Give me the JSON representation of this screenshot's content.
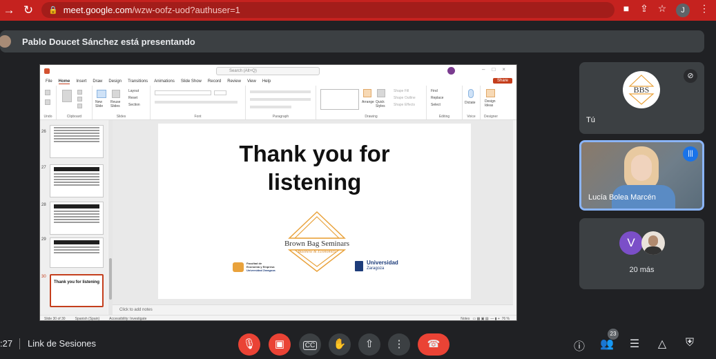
{
  "browser": {
    "url_domain": "meet.google.com",
    "url_path": "/wzw-oofz-uod?authuser=1",
    "profile_initial": "J",
    "accent": "#c5221f"
  },
  "presenter_bar": {
    "text": "Pablo Doucet Sánchez está presentando"
  },
  "ppt": {
    "menus": [
      "File",
      "Home",
      "Insert",
      "Draw",
      "Design",
      "Transitions",
      "Animations",
      "Slide Show",
      "Record",
      "Review",
      "View",
      "Help"
    ],
    "share_label": "Share",
    "search_placeholder": "Search (Alt+Q)",
    "ribbon": {
      "groups": [
        "Undo",
        "Clipboard",
        "Slides",
        "Font",
        "Paragraph",
        "Drawing",
        "Editing",
        "Voice",
        "Designer"
      ],
      "new_slide": "New Slide",
      "reuse_slides": "Reuse Slides",
      "layout": "Layout",
      "reset": "Reset",
      "section": "Section",
      "arrange": "Arrange",
      "quick_styles": "Quick Styles",
      "shape_fill": "Shape Fill",
      "shape_outline": "Shape Outline",
      "shape_effects": "Shape Effects",
      "find": "Find",
      "replace": "Replace",
      "select": "Select",
      "dictate": "Dictate",
      "design_ideas": "Design Ideas"
    },
    "thumbs": [
      {
        "num": "26",
        "title": ""
      },
      {
        "num": "27",
        "title": ""
      },
      {
        "num": "28",
        "title": ""
      },
      {
        "num": "29",
        "title": ""
      },
      {
        "num": "30",
        "title": "Thank you for listening"
      }
    ],
    "slide": {
      "title_line1": "Thank you for",
      "title_line2": "listening",
      "logo_name": "Brown Bag Seminars",
      "logo_sub": "Business & Economics",
      "faculty_line1": "Facultad de",
      "faculty_line2": "Economía y Empresa",
      "faculty_line3": "Universidad Zaragoza",
      "univ_line1": "Universidad",
      "univ_line2": "Zaragoza"
    },
    "notes_placeholder": "Click to add notes",
    "status": {
      "slide_of": "Slide 30 of 30",
      "language": "Spanish (Spain)",
      "accessibility": "Accessibility: Investigate",
      "notes": "Notes",
      "zoom": "76 %"
    }
  },
  "tiles": {
    "you": {
      "name": "Tú",
      "logo_text": "BBS"
    },
    "lucia": {
      "name": "Lucía Bolea Marcén"
    },
    "more": {
      "label": "20 más",
      "avatar_initial": "V"
    }
  },
  "bottom": {
    "time": ":27",
    "meeting_title": "Link de Sesiones",
    "people_count": "23"
  }
}
